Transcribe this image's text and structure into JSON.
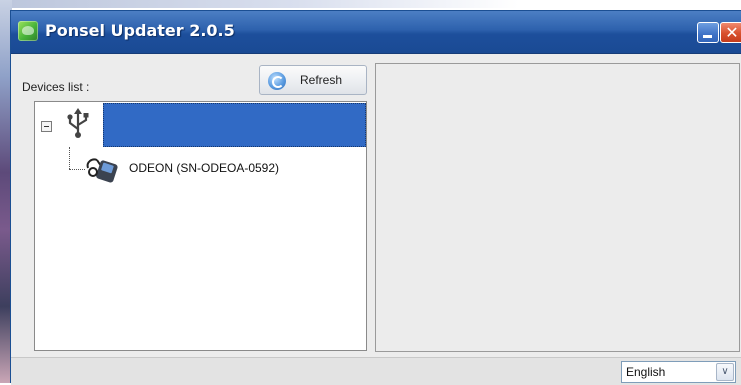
{
  "window": {
    "title": "Ponsel Updater 2.0.5",
    "minimize_glyph": "",
    "close_glyph": "✕"
  },
  "devices": {
    "label": "Devices list :",
    "refresh_label": "Refresh",
    "tree": {
      "root_icon": "usb-icon",
      "root_selected": true,
      "children": [
        {
          "label": "ODEON (SN-ODEOA-0592)",
          "icon": "phone-device-icon"
        }
      ]
    }
  },
  "statusbar": {
    "language": "English",
    "language_arrow": "∨"
  },
  "colors": {
    "titlebar": "#2d61ad",
    "selection": "#316ac5",
    "window_bg": "#ececec",
    "close_button": "#d8502e"
  }
}
